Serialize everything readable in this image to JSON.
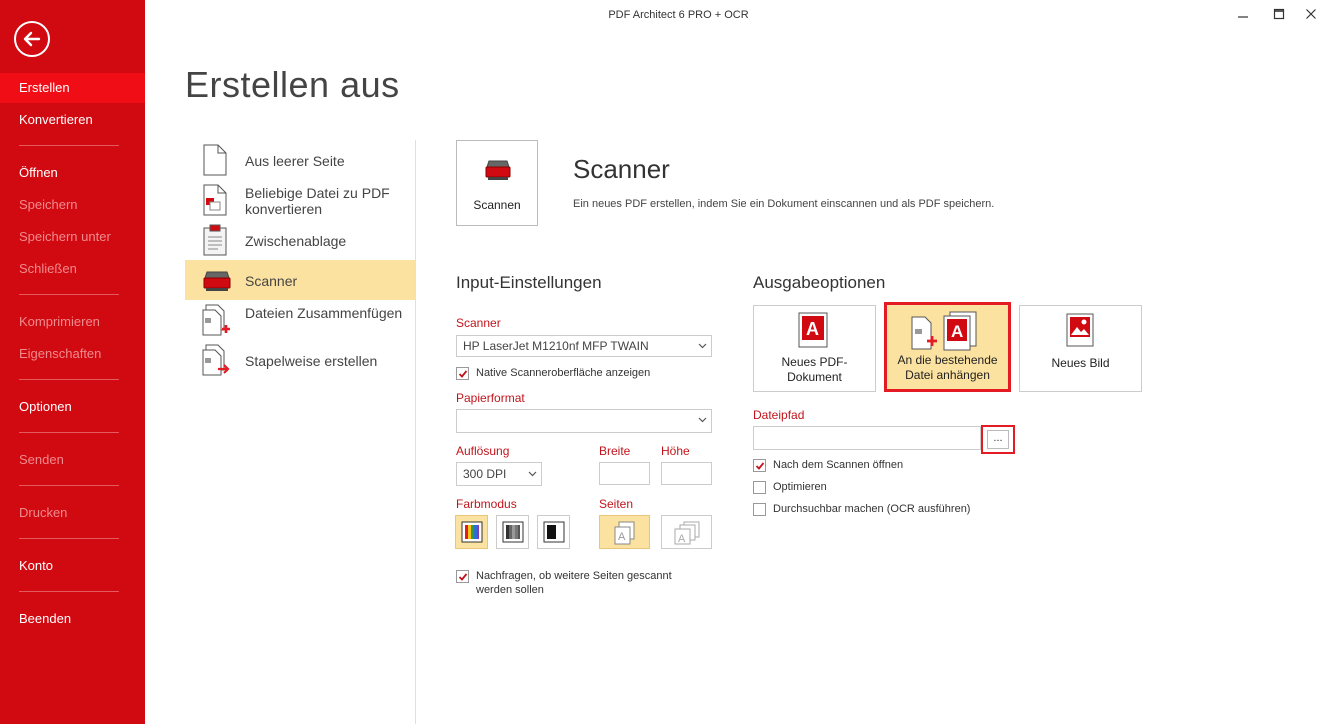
{
  "window": {
    "title": "PDF Architect 6 PRO + OCR"
  },
  "sidebar": {
    "items": [
      {
        "label": "Erstellen",
        "state": "active"
      },
      {
        "label": "Konvertieren",
        "state": "normal"
      },
      {
        "label": "Öffnen",
        "state": "normal"
      },
      {
        "label": "Speichern",
        "state": "disabled"
      },
      {
        "label": "Speichern unter",
        "state": "disabled"
      },
      {
        "label": "Schließen",
        "state": "disabled"
      },
      {
        "label": "Komprimieren",
        "state": "disabled"
      },
      {
        "label": "Eigenschaften",
        "state": "disabled"
      },
      {
        "label": "Optionen",
        "state": "normal"
      },
      {
        "label": "Senden",
        "state": "disabled"
      },
      {
        "label": "Drucken",
        "state": "disabled"
      },
      {
        "label": "Konto",
        "state": "normal"
      },
      {
        "label": "Beenden",
        "state": "normal"
      }
    ]
  },
  "page_title": "Erstellen aus",
  "create_list": [
    {
      "label": "Aus leerer Seite",
      "icon": "blank-page-icon"
    },
    {
      "label": "Beliebige Datei zu PDF konvertieren",
      "icon": "convert-file-icon"
    },
    {
      "label": "Zwischenablage",
      "icon": "clipboard-icon"
    },
    {
      "label": "Scanner",
      "icon": "scanner-icon",
      "active": true
    },
    {
      "label": "Dateien Zusammenfügen",
      "icon": "merge-files-icon"
    },
    {
      "label": "Stapelweise erstellen",
      "icon": "batch-create-icon"
    }
  ],
  "scanner": {
    "button_label": "Scannen",
    "title": "Scanner",
    "description": "Ein neues PDF erstellen, indem Sie ein Dokument einscannen und als PDF speichern."
  },
  "input": {
    "title": "Input-Einstellungen",
    "scanner_label": "Scanner",
    "scanner_value": "HP LaserJet M1210nf MFP TWAIN",
    "native_ui_label": "Native Scanneroberfläche anzeigen",
    "native_ui_checked": true,
    "paper_label": "Papierformat",
    "paper_value": "",
    "resolution_label": "Auflösung",
    "resolution_value": "300 DPI",
    "width_label": "Breite",
    "height_label": "Höhe",
    "color_label": "Farbmodus",
    "color_modes": [
      "color",
      "grayscale",
      "black-white"
    ],
    "color_selected": "color",
    "pages_label": "Seiten",
    "pages_modes": [
      "single-page",
      "multi-page"
    ],
    "pages_selected": "single-page",
    "ask_more_label": "Nachfragen, ob weitere Seiten gescannt werden sollen",
    "ask_more_checked": true
  },
  "output": {
    "title": "Ausgabeoptionen",
    "tiles": [
      {
        "label": "Neues PDF-Dokument",
        "active": false
      },
      {
        "label": "An die bestehende Datei anhängen",
        "active": true
      },
      {
        "label": "Neues Bild",
        "active": false
      }
    ],
    "filepath_label": "Dateipfad",
    "filepath_value": "",
    "browse_label": "...",
    "open_after_label": "Nach dem Scannen öffnen",
    "open_after_checked": true,
    "optimize_label": "Optimieren",
    "optimize_checked": false,
    "ocr_label": "Durchsuchbar machen (OCR ausführen)",
    "ocr_checked": false
  },
  "colors": {
    "brand_red": "#d10a11",
    "active_nav": "#f10d16",
    "highlight": "#fbe2a0",
    "accent_red": "#e41b22"
  }
}
